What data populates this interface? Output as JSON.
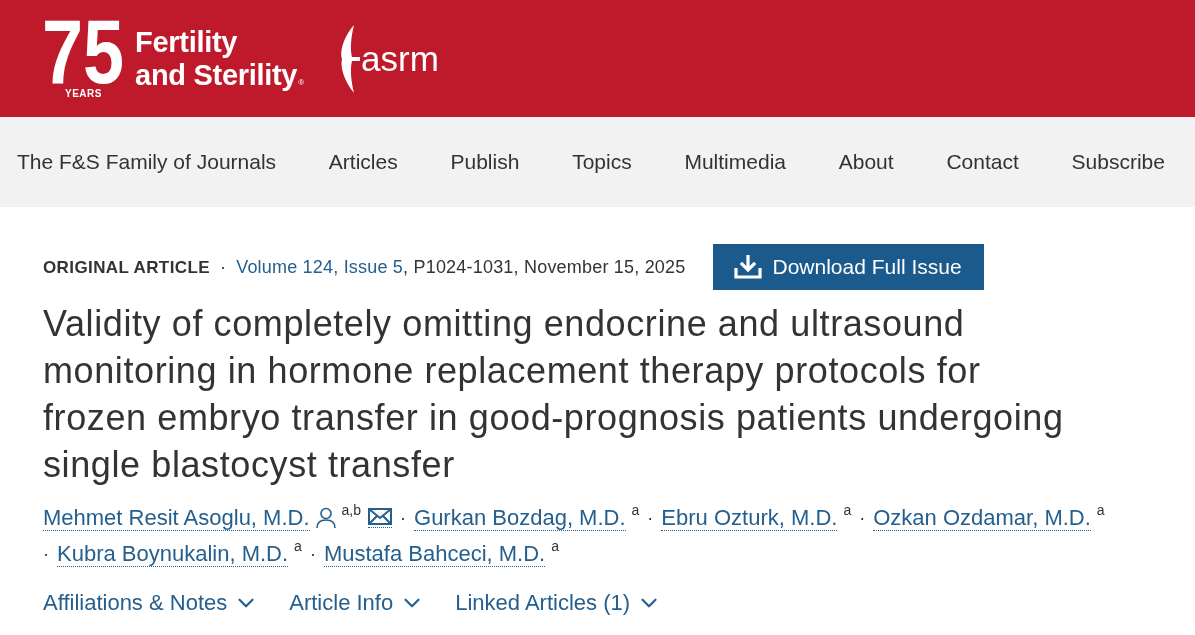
{
  "header": {
    "logo": {
      "number": "75",
      "badge": "YEARS",
      "name_lines": [
        "Fertility",
        "and Sterility"
      ],
      "registered_mark": "®"
    },
    "society_logo": {
      "text": "asrm"
    }
  },
  "nav": {
    "items": [
      "The F&S Family of Journals",
      "Articles",
      "Publish",
      "Topics",
      "Multimedia",
      "About",
      "Contact",
      "Subscribe"
    ]
  },
  "article": {
    "type": "ORIGINAL ARTICLE",
    "separator": "·",
    "issue_link": "Volume 124, Issue 5",
    "details": ", P1024-1031, November 15, 2025",
    "download_button": "Download Full Issue",
    "title": "Validity of completely omitting endocrine and ultrasound monitoring in hormone replacement therapy protocols for frozen embryo transfer in good-prognosis patients undergoing single blastocyst transfer",
    "authors": [
      {
        "name": "Mehmet Resit Asoglu, M.D.",
        "profile_icon": true,
        "affiliations": "a,b",
        "email_icon": true
      },
      {
        "separator": "·",
        "name": "Gurkan Bozdag, M.D.",
        "profile_icon": false,
        "affiliations": "a",
        "email_icon": false
      },
      {
        "separator": "·",
        "name": "Ebru Ozturk, M.D.",
        "profile_icon": false,
        "affiliations": "a",
        "email_icon": false
      },
      {
        "separator": "·",
        "name": "Ozkan Ozdamar, M.D.",
        "profile_icon": false,
        "affiliations": "a",
        "email_icon": false
      },
      {
        "separator": "·",
        "name": "Kubra Boynukalin, M.D.",
        "profile_icon": false,
        "affiliations": "a",
        "email_icon": false
      },
      {
        "separator": "·",
        "name": "Mustafa Bahceci, M.D.",
        "profile_icon": false,
        "affiliations": "a",
        "email_icon": false
      }
    ],
    "sections": [
      {
        "label": "Affiliations & Notes",
        "expanded": false
      },
      {
        "label": "Article Info",
        "expanded": false
      },
      {
        "label": "Linked Articles (1)",
        "expanded": false
      }
    ]
  }
}
